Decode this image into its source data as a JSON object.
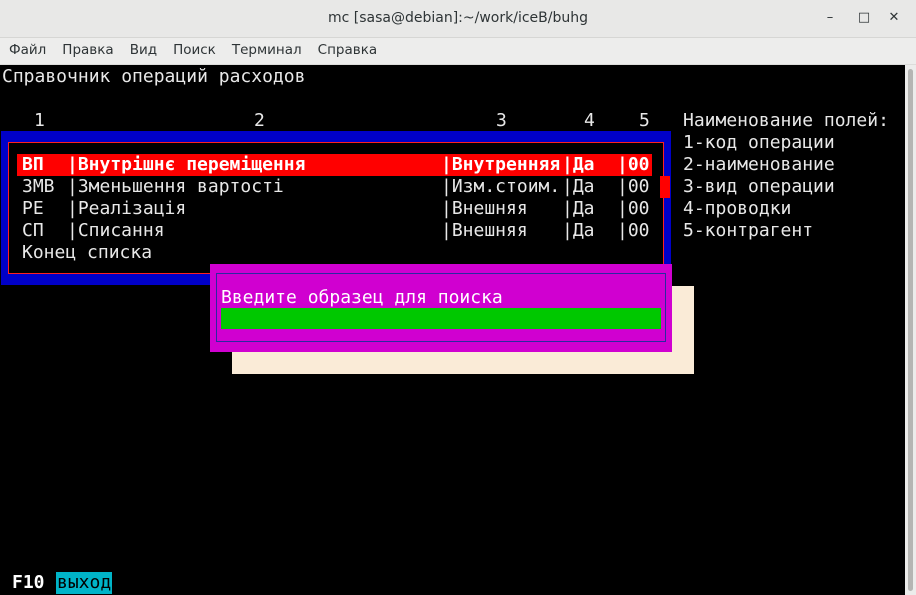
{
  "window": {
    "title": "mc [sasa@debian]:~/work/iceB/buhg",
    "minimize": "–",
    "maximize": "□",
    "close": "✕"
  },
  "menu": [
    "Файл",
    "Правка",
    "Вид",
    "Поиск",
    "Терминал",
    "Справка"
  ],
  "screen": {
    "heading": "Справочник операций расходов",
    "column_numbers": [
      "1",
      "2",
      "3",
      "4",
      "5"
    ],
    "legend_title": "Наименование полей:",
    "legend": [
      "1-код операции",
      "2-наименование",
      "3-вид операции",
      "4-проводки",
      "5-контрагент"
    ]
  },
  "list": {
    "rows": [
      {
        "code": "ВП",
        "name": "|Внутрішнє переміщення",
        "kind": "|Внутренняя",
        "post": "|Да",
        "contr": "|00"
      },
      {
        "code": "ЗМВ",
        "name": "|Зменьшення вартості",
        "kind": "|Изм.стоим.",
        "post": "|Да",
        "contr": "|00"
      },
      {
        "code": "РЕ",
        "name": "|Реалізація",
        "kind": "|Внешняя",
        "post": "|Да",
        "contr": "|00"
      },
      {
        "code": "СП",
        "name": "|Списання",
        "kind": "|Внешняя",
        "post": "|Да",
        "contr": "|00"
      }
    ],
    "end_marker": "Конец списка",
    "selected_index": 0
  },
  "search_dialog": {
    "prompt": "Введите образец для поиска",
    "value": ""
  },
  "hotkeys": {
    "key": "F10",
    "label": "выход"
  },
  "colors": {
    "panel_blue": "#0000c8",
    "selection_red": "#ff0000",
    "dialog_magenta": "#d000d0",
    "input_green": "#00c800",
    "shadow_cream": "#faebd7",
    "hotkey_cyan": "#00b4c8"
  }
}
